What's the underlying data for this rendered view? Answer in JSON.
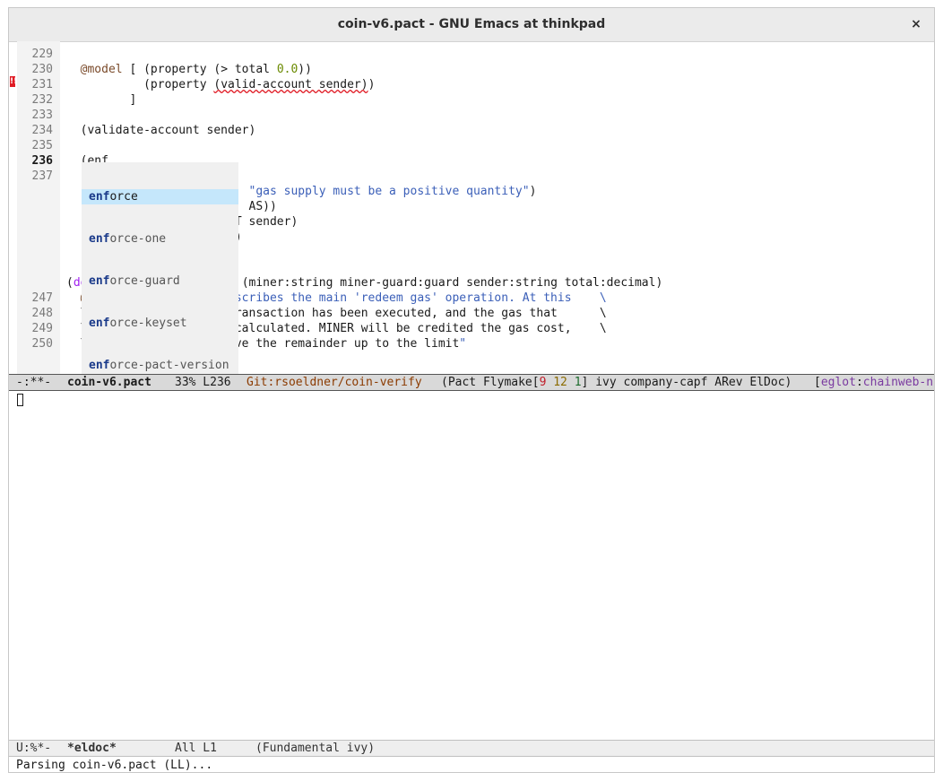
{
  "window": {
    "title": "coin-v6.pact - GNU Emacs at thinkpad",
    "close_glyph": "×"
  },
  "editor": {
    "lines": [
      {
        "num": "229",
        "text": ""
      },
      {
        "num": "230",
        "text": "  @model [ (property (> total 0.0))"
      },
      {
        "num": "231",
        "text": "           (property (valid-account sender))"
      },
      {
        "num": "232",
        "text": "         ]"
      },
      {
        "num": "233",
        "text": ""
      },
      {
        "num": "234",
        "text": "  (validate-account sender)"
      },
      {
        "num": "235",
        "text": ""
      },
      {
        "num": "236",
        "text": "  (enf"
      },
      {
        "num": "237",
        "text": ""
      },
      {
        "num": "",
        "text": "                          \"gas supply must be a positive quantity\")"
      },
      {
        "num": "",
        "text": "                          AS))"
      },
      {
        "num": "",
        "text": "  (with-capability (DEBIT sender)"
      },
      {
        "num": "",
        "text": "    (debit sender total))"
      },
      {
        "num": "",
        "text": "  )"
      },
      {
        "num": "",
        "text": ""
      },
      {
        "num": "",
        "text": "(defun redeem-gas:string (miner:string miner-guard:guard sender:string total:decimal)"
      },
      {
        "num": "247",
        "text": "  @doc \"This function describes the main 'redeem gas' operation. At this    \\"
      },
      {
        "num": "248",
        "text": "  \\point, the SENDER's transaction has been executed, and the gas that      \\"
      },
      {
        "num": "249",
        "text": "  \\was charged has been calculated. MINER will be credited the gas cost,    \\"
      },
      {
        "num": "250",
        "text": "  \\and SENDER will receive the remainder up to the limit\""
      }
    ],
    "current_line": "236",
    "flymake_marker": "!!"
  },
  "completion": {
    "prefix": "enf",
    "items": [
      {
        "prefix": "enf",
        "suffix": "orce"
      },
      {
        "prefix": "enf",
        "suffix": "orce-one"
      },
      {
        "prefix": "enf",
        "suffix": "orce-guard"
      },
      {
        "prefix": "enf",
        "suffix": "orce-keyset"
      },
      {
        "prefix": "enf",
        "suffix": "orce-pact-version"
      }
    ]
  },
  "modeline_main": {
    "state": "-:**-",
    "buffer": "coin-v6.pact",
    "position": "33% L236",
    "git": "Git:rsoeldner/coin-verify",
    "modes_open": "(Pact Flymake[",
    "fly_err": "9",
    "fly_warn": "12",
    "fly_note": "1",
    "modes_close": "] ivy company-capf ARev ElDoc)",
    "eglot_open": "[",
    "eglot_label": "eglot",
    "eglot_sep": ":",
    "eglot_server": "chainweb-n"
  },
  "modeline_eldoc": {
    "state": "U:%*-",
    "buffer": "*eldoc*",
    "position": "All L1",
    "modes": "(Fundamental ivy)"
  },
  "echo_area": {
    "message": "Parsing coin-v6.pact (LL)..."
  }
}
